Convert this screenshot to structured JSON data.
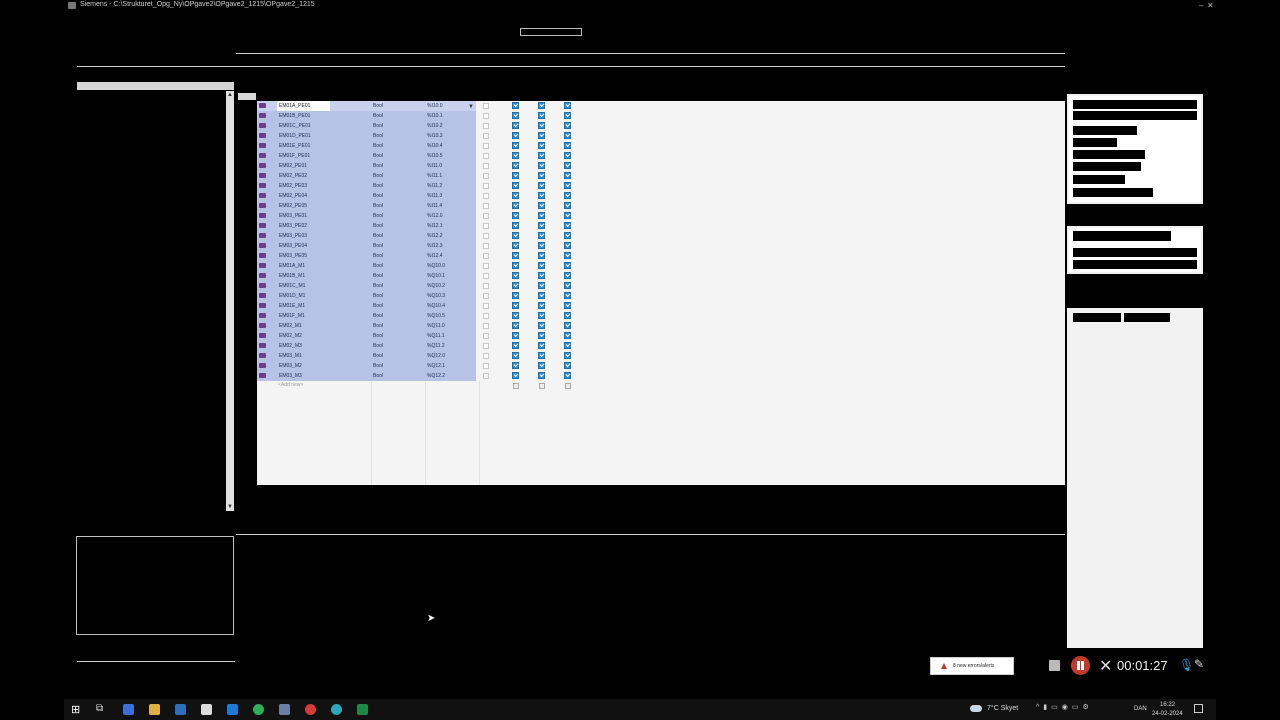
{
  "window": {
    "title": "Siemens - C:\\Strukturet_Opg_Ny\\OPgave2\\OPgave2_1215\\OPgave2_1215",
    "minimize": "–",
    "close": "✕"
  },
  "tags": [
    {
      "name": "EM01A_PE01",
      "type": "Bool",
      "address": "%I10.0"
    },
    {
      "name": "EM01B_PE01",
      "type": "Bool",
      "address": "%I10.1"
    },
    {
      "name": "EM01C_PE01",
      "type": "Bool",
      "address": "%I10.2"
    },
    {
      "name": "EM01D_PE01",
      "type": "Bool",
      "address": "%I10.3"
    },
    {
      "name": "EM01E_PE01",
      "type": "Bool",
      "address": "%I10.4"
    },
    {
      "name": "EM01F_PE01",
      "type": "Bool",
      "address": "%I10.5"
    },
    {
      "name": "EM02_PE01",
      "type": "Bool",
      "address": "%I11.0"
    },
    {
      "name": "EM02_PE02",
      "type": "Bool",
      "address": "%I11.1"
    },
    {
      "name": "EM02_PE03",
      "type": "Bool",
      "address": "%I11.2"
    },
    {
      "name": "EM02_PE04",
      "type": "Bool",
      "address": "%I11.3"
    },
    {
      "name": "EM02_PE05",
      "type": "Bool",
      "address": "%I11.4"
    },
    {
      "name": "EM03_PE01",
      "type": "Bool",
      "address": "%I12.0"
    },
    {
      "name": "EM03_PE02",
      "type": "Bool",
      "address": "%I12.1"
    },
    {
      "name": "EM03_PE03",
      "type": "Bool",
      "address": "%I12.2"
    },
    {
      "name": "EM03_PE04",
      "type": "Bool",
      "address": "%I12.3"
    },
    {
      "name": "EM03_PE05",
      "type": "Bool",
      "address": "%I12.4"
    },
    {
      "name": "EM01A_M1",
      "type": "Bool",
      "address": "%Q10.0"
    },
    {
      "name": "EM01B_M1",
      "type": "Bool",
      "address": "%Q10.1"
    },
    {
      "name": "EM01C_M1",
      "type": "Bool",
      "address": "%Q10.2"
    },
    {
      "name": "EM01D_M1",
      "type": "Bool",
      "address": "%Q10.3"
    },
    {
      "name": "EM01E_M1",
      "type": "Bool",
      "address": "%Q10.4"
    },
    {
      "name": "EM01F_M1",
      "type": "Bool",
      "address": "%Q10.5"
    },
    {
      "name": "EM02_M1",
      "type": "Bool",
      "address": "%Q11.0"
    },
    {
      "name": "EM02_M2",
      "type": "Bool",
      "address": "%Q11.1"
    },
    {
      "name": "EM02_M3",
      "type": "Bool",
      "address": "%Q11.2"
    },
    {
      "name": "EM03_M1",
      "type": "Bool",
      "address": "%Q12.0"
    },
    {
      "name": "EM03_M2",
      "type": "Bool",
      "address": "%Q12.1"
    },
    {
      "name": "EM03_M3",
      "type": "Bool",
      "address": "%Q12.2"
    }
  ],
  "table": {
    "add_new": "<Add new>"
  },
  "alert": {
    "text": "8 new errors/alerts"
  },
  "recorder": {
    "time": "00:01:27"
  },
  "taskbar": {
    "weather": "7°C Skyet",
    "language": "DAN",
    "time": "16:22",
    "date": "24-02-2024"
  },
  "colors": {
    "selection": "#b6c2e6",
    "checkbox": "#2f8fd0",
    "record": "#c0392b"
  }
}
